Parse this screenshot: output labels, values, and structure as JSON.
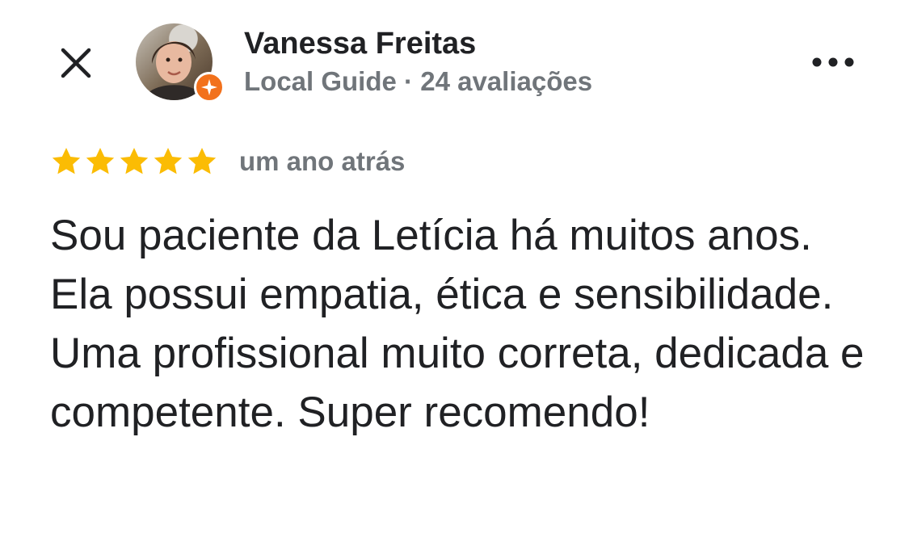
{
  "reviewer": {
    "name": "Vanessa Freitas",
    "level": "Local Guide",
    "separator": "·",
    "review_count": "24 avaliações",
    "avatar_icon": "user-photo",
    "badge_icon": "local-guide-star-icon",
    "badge_color": "#f2711c"
  },
  "actions": {
    "close_icon": "close-icon",
    "more_icon": "more-options-icon"
  },
  "rating": {
    "stars": 5,
    "max": 5,
    "star_color": "#fbbc04",
    "date": "um ano atrás"
  },
  "review": {
    "text": "Sou paciente da Letícia há muitos anos. Ela possui empatia, ética e sensibilidade. Uma profissional muito correta, dedicada e competente. Super recomendo!"
  }
}
